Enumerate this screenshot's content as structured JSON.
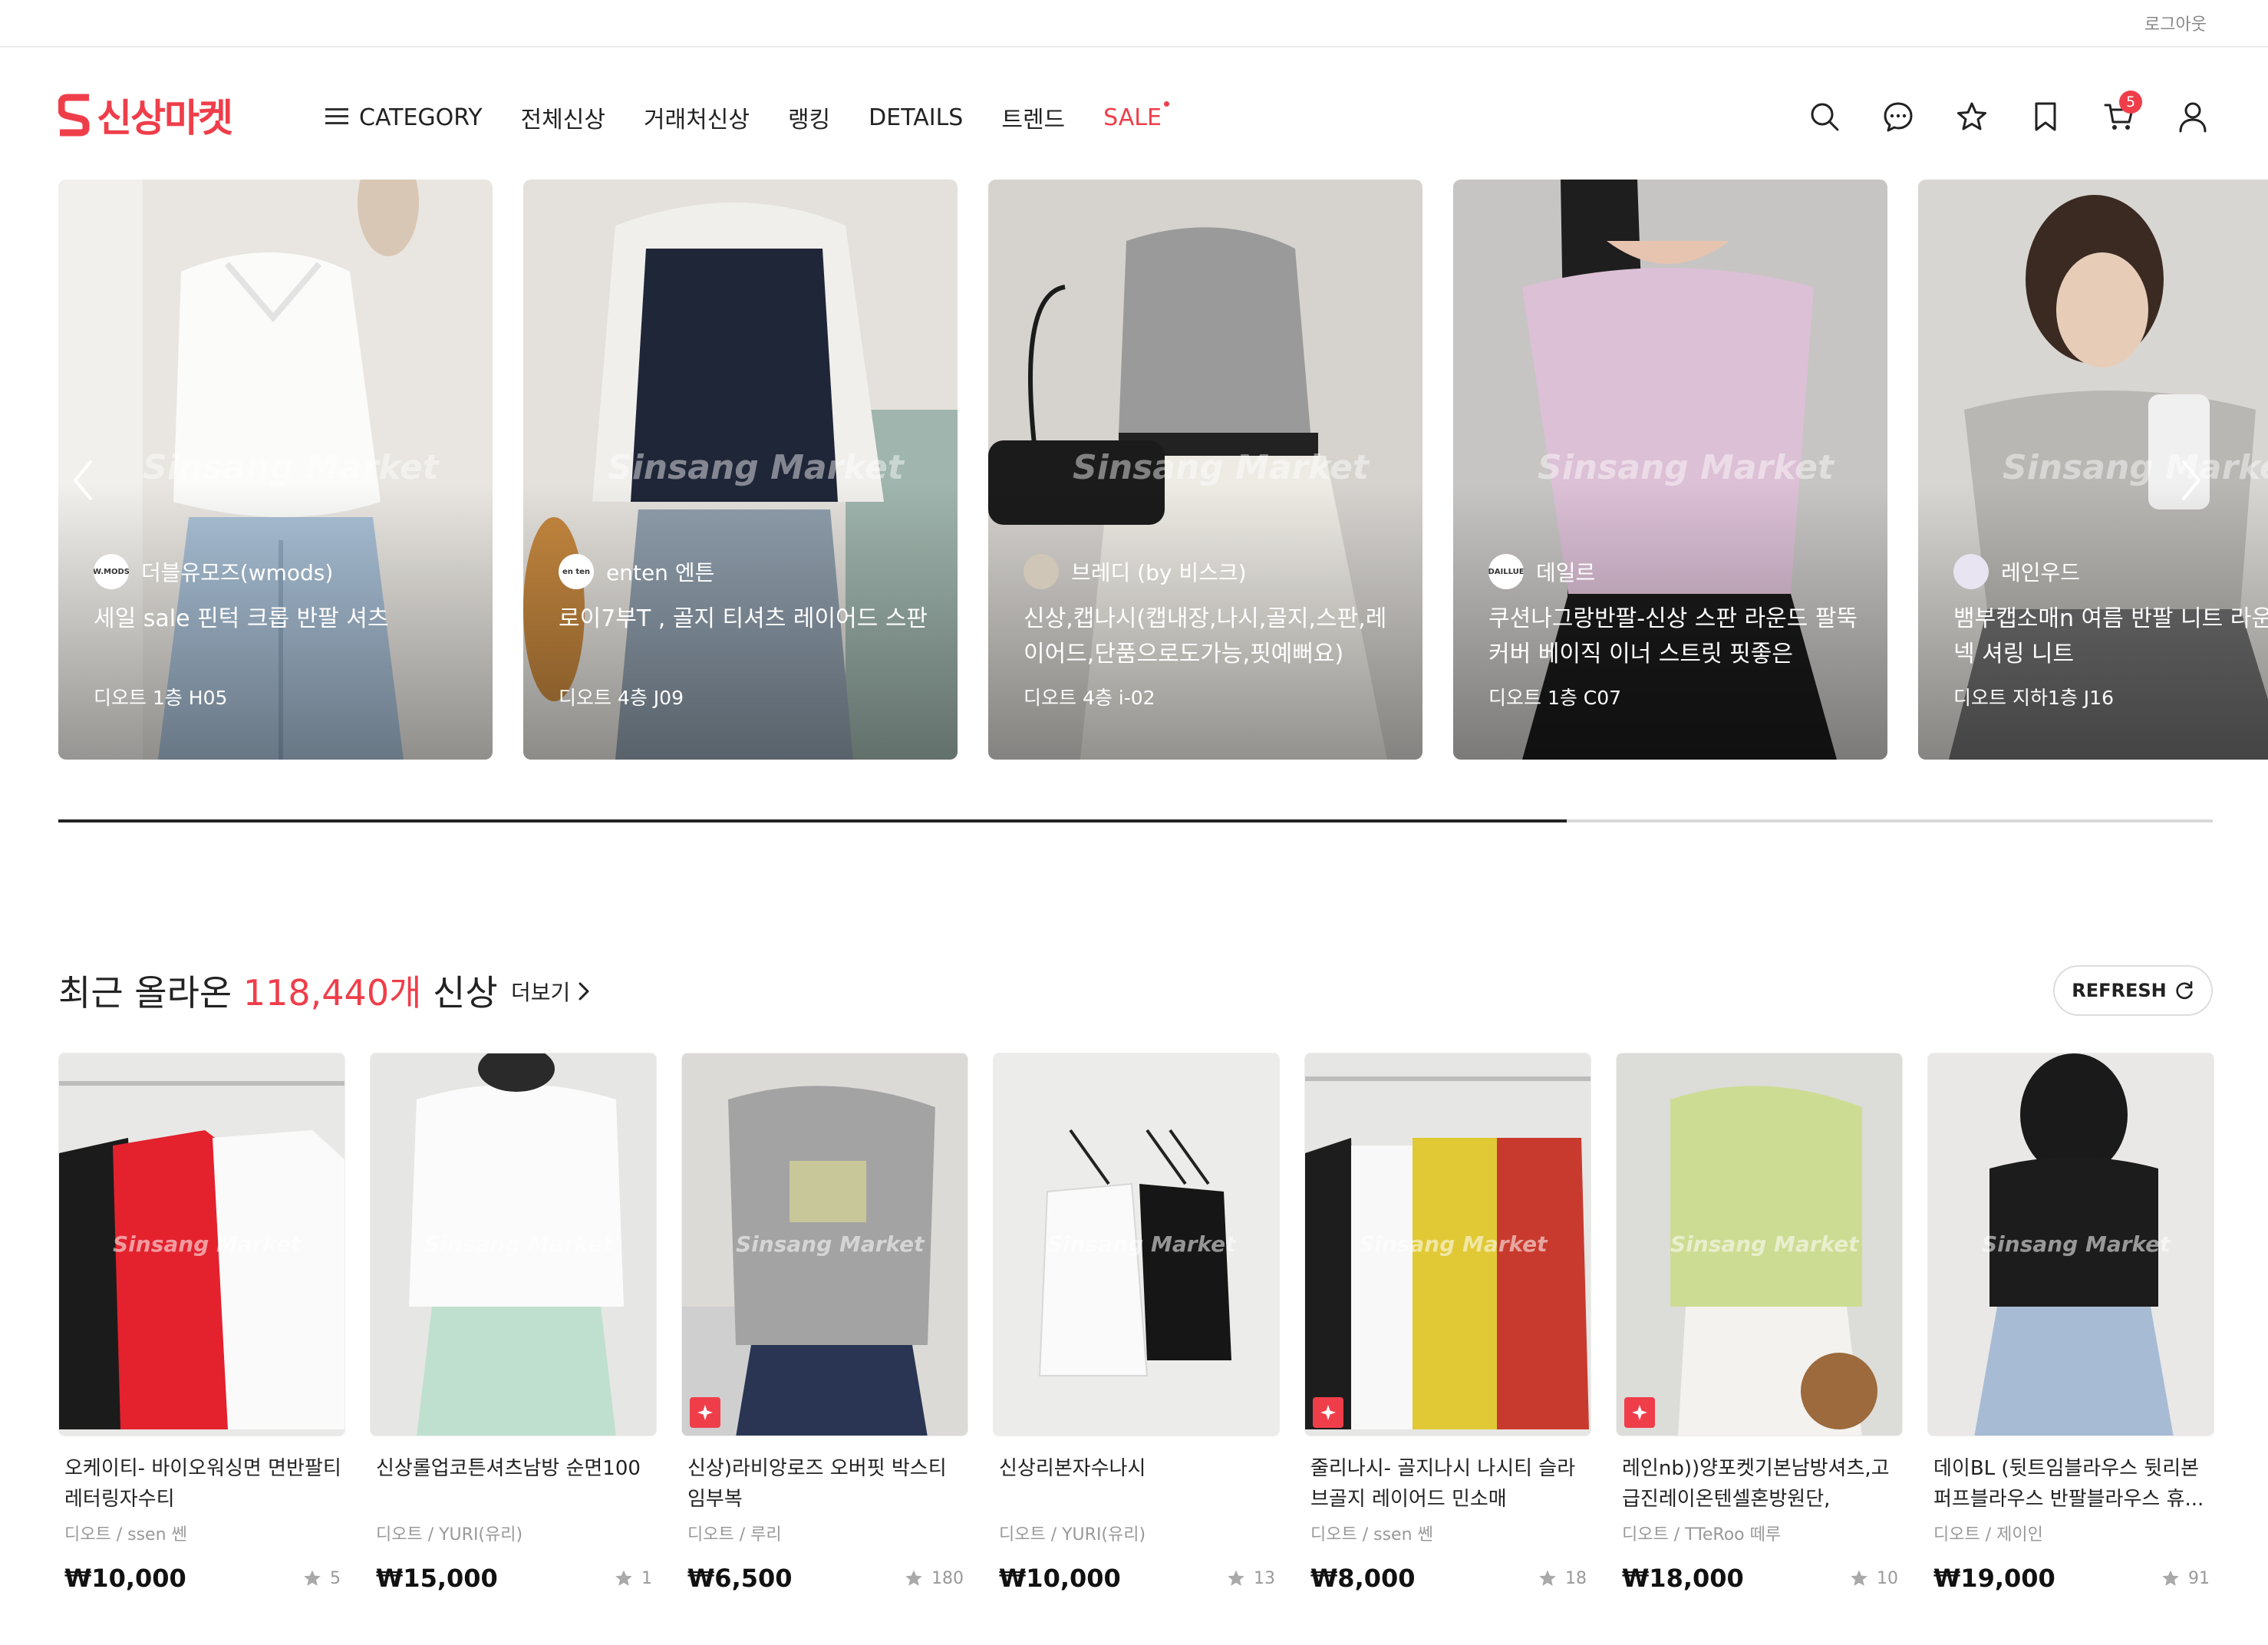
{
  "topbar": {
    "logout": "로그아웃"
  },
  "brand": {
    "name": "신상마켓",
    "color": "#ef3e4a"
  },
  "nav": {
    "category": "CATEGORY",
    "all_new": "전체신상",
    "partner_new": "거래처신상",
    "ranking": "랭킹",
    "details": "DETAILS",
    "trend": "트렌드",
    "sale": "SALE"
  },
  "header_icons": [
    "search-icon",
    "chat-icon",
    "star-icon",
    "bookmark-icon",
    "cart-icon",
    "user-icon"
  ],
  "cart": {
    "count": "5"
  },
  "banners": [
    {
      "store": "더블유모즈(wmods)",
      "title": "세일 sale 핀턱 크롭 반팔 셔츠",
      "location": "디오트 1층 H05",
      "watermark": "Sinsang Market",
      "logo": "W.MODS"
    },
    {
      "store": "enten 엔튼",
      "title": "로이7부T , 골지 티셔츠 레이어드 스판",
      "location": "디오트 4층 J09",
      "watermark": "Sinsang Market",
      "logo": "en ten"
    },
    {
      "store": "브레디 (by 비스크)",
      "title": "신상,캡나시(캡내장,나시,골지,스판,레이어드,단품으로도가능,핏예뻐요)",
      "location": "디오트 4층 i-02",
      "watermark": "Sinsang Market",
      "logo": ""
    },
    {
      "store": "데일르",
      "title": "쿠션나그랑반팔-신상 스판 라운드 팔뚝커버 베이직 이너 스트릿 핏좋은",
      "location": "디오트 1층 C07",
      "watermark": "Sinsang Market",
      "logo": "DAILLUE"
    },
    {
      "store": "레인우드",
      "title": "뱀부캡소매n 여름 반팔 니트 라운드 유넥 셔링 니트",
      "location": "디오트 지하1층 J16",
      "watermark": "Sinsang Market",
      "logo": ""
    }
  ],
  "carousel_progress": 0.7,
  "section": {
    "title_prefix": "최근 올라온 ",
    "count": "118,440개",
    "title_suffix": " 신상",
    "more": "더보기",
    "refresh": "REFRESH"
  },
  "products": [
    {
      "name": "오케이티- 바이오워싱면 면반팔티 레터링자수티",
      "store": "디오트 / ssen 쎈",
      "price": "₩10,000",
      "favs": "5",
      "watermark": "Sinsang Market",
      "badge": false
    },
    {
      "name": "신상롤업코튼셔츠남방 순면100",
      "store": "디오트 / YURI(유리)",
      "price": "₩15,000",
      "favs": "1",
      "watermark": "Sinsang Market",
      "badge": false
    },
    {
      "name": "신상)라비앙로즈 오버핏 박스티 임부복",
      "store": "디오트 / 루리",
      "price": "₩6,500",
      "favs": "180",
      "watermark": "Sinsang Market",
      "badge": true
    },
    {
      "name": "신상리본자수나시",
      "store": "디오트 / YURI(유리)",
      "price": "₩10,000",
      "favs": "13",
      "watermark": "Sinsang Market",
      "badge": false
    },
    {
      "name": "줄리나시- 골지나시 나시티 슬라브골지 레이어드 민소매",
      "store": "디오트 / ssen 쎈",
      "price": "₩8,000",
      "favs": "18",
      "watermark": "Sinsang Market",
      "badge": true
    },
    {
      "name": "레인nb))양포켓기본남방셔츠,고급진레이온텐셀혼방원단,",
      "store": "디오트 / TTeRoo 떼루",
      "price": "₩18,000",
      "favs": "10",
      "watermark": "Sinsang Market",
      "badge": true
    },
    {
      "name": "데이BL (뒷트임블라우스 뒷리본 퍼프블라우스 반팔블라우스 휴...",
      "store": "디오트 / 제이인",
      "price": "₩19,000",
      "favs": "91",
      "watermark": "Sinsang Market",
      "badge": false
    }
  ]
}
